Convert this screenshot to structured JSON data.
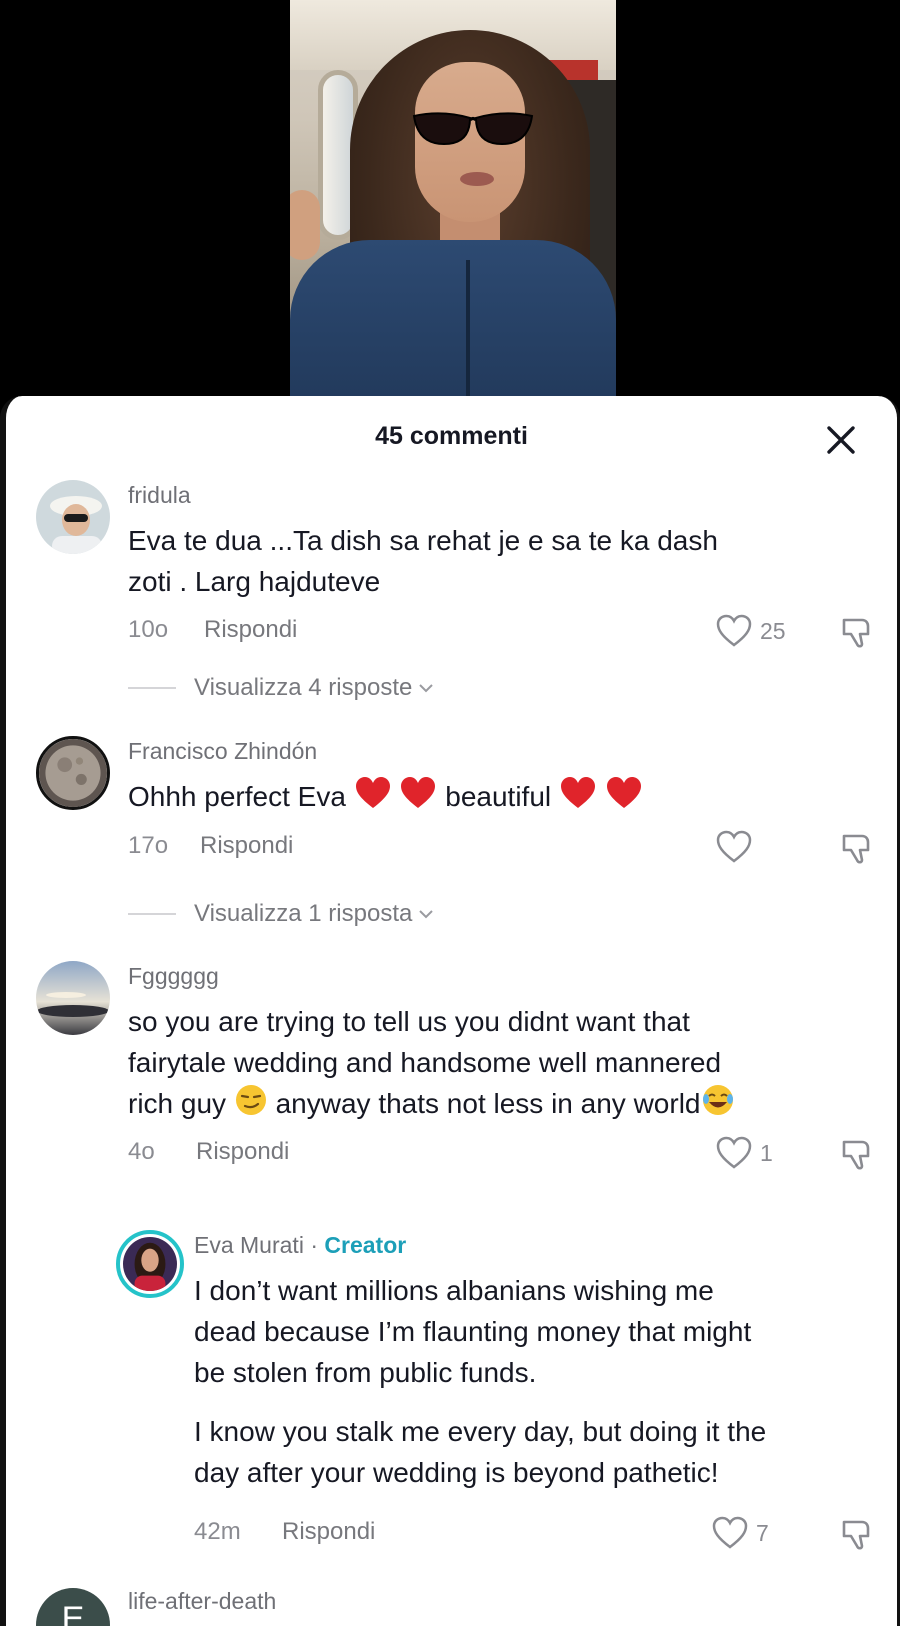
{
  "sheet": {
    "title": "45 commenti"
  },
  "comments": [
    {
      "username": "fridula",
      "text_lines": [
        "Eva te dua ...Ta dish sa rehat je e sa te ka dash",
        "zoti . Larg hajduteve"
      ],
      "time": "10o",
      "reply_label": "Rispondi",
      "likes": "25",
      "view_replies": "Visualizza 4 risposte"
    },
    {
      "username": "Francisco Zhindón",
      "text_parts": [
        "Ohhh perfect Eva",
        "beautiful"
      ],
      "time": "17o",
      "reply_label": "Rispondi",
      "likes": "",
      "view_replies": "Visualizza 1 risposta"
    },
    {
      "username": "Fgggggg",
      "text_lines": [
        "so you are trying to tell us you didnt want that",
        "fairytale wedding and handsome well mannered"
      ],
      "text_line3_parts": [
        "rich guy",
        "anyway thats not less in any world"
      ],
      "time": "4o",
      "reply_label": "Rispondi",
      "likes": "1"
    },
    {
      "username": "Eva Murati",
      "badge": "Creator",
      "separator": "·",
      "paragraph1": [
        "I don’t want millions albanians wishing me",
        "dead because I’m flaunting money that might",
        "be stolen from public funds."
      ],
      "paragraph2": [
        "I know you stalk me every day, but doing it the",
        "day after your wedding is beyond pathetic!"
      ],
      "time": "42m",
      "reply_label": "Rispondi",
      "likes": "7"
    },
    {
      "username": "life-after-death",
      "avatar_letter": "E"
    }
  ],
  "colors": {
    "creator_badge": "#1c9fb8",
    "heart_emoji": "#e0242b",
    "text_primary": "#161823",
    "text_secondary": "#8a8b91"
  }
}
